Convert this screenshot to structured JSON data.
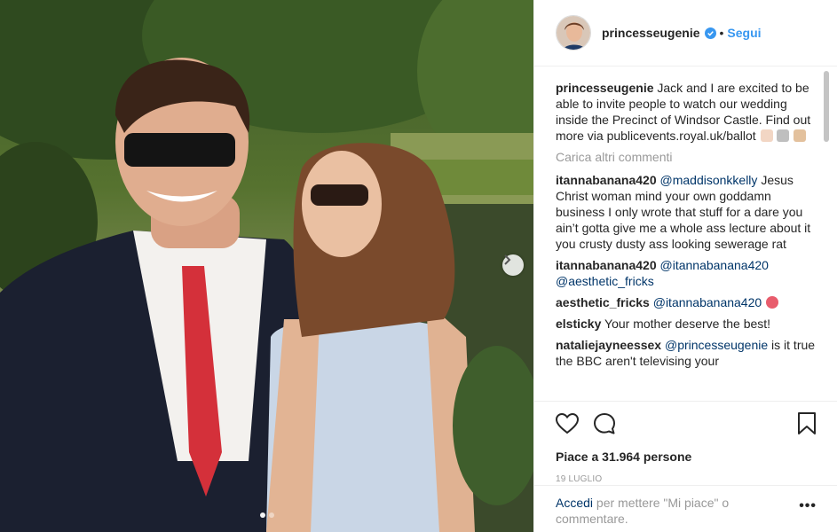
{
  "post": {
    "username": "princesseugenie",
    "follow_label": "Segui",
    "separator": "•",
    "caption": {
      "username": "princesseugenie",
      "text": "Jack and I are excited to be able to invite people to watch our wedding inside the Precinct of Windsor Castle. Find out more via publicevents.royal.uk/ballot"
    },
    "load_more_label": "Carica altri commenti",
    "comments": [
      {
        "username": "itannabanana420",
        "mention": "@maddisonkkelly",
        "text": "Jesus Christ woman mind your own goddamn business I only wrote that stuff for a dare you ain’t gotta give me a whole ass lecture about it you crusty dusty ass looking sewerage rat"
      },
      {
        "username": "itannabanana420",
        "mention": "@itannabanana420",
        "mention2": "@aesthetic_fricks",
        "text": ""
      },
      {
        "username": "aesthetic_fricks",
        "mention": "@itannabanana420",
        "text": ""
      },
      {
        "username": "elsticky",
        "mention": "",
        "text": "Your mother deserve the best!"
      },
      {
        "username": "nataliejayneessex",
        "mention": "@princesseugenie",
        "text": "is it true the BBC aren't televising your"
      }
    ],
    "likes_text": "Piace a 31.964 persone",
    "date": "19 luglio",
    "login_link": "Accedi",
    "login_rest": "per mettere \"Mi piace\" o commentare.",
    "more_options": "•••"
  },
  "icons": {
    "verified": "verified-badge-icon",
    "like": "heart-icon",
    "comment": "comment-bubble-icon",
    "bookmark": "bookmark-icon",
    "next": "chevron-right-icon"
  },
  "colors": {
    "link_blue": "#3897f0",
    "mention_blue": "#003569",
    "muted": "#999999",
    "text": "#262626"
  },
  "carousel": {
    "slides": 2,
    "active": 1
  }
}
